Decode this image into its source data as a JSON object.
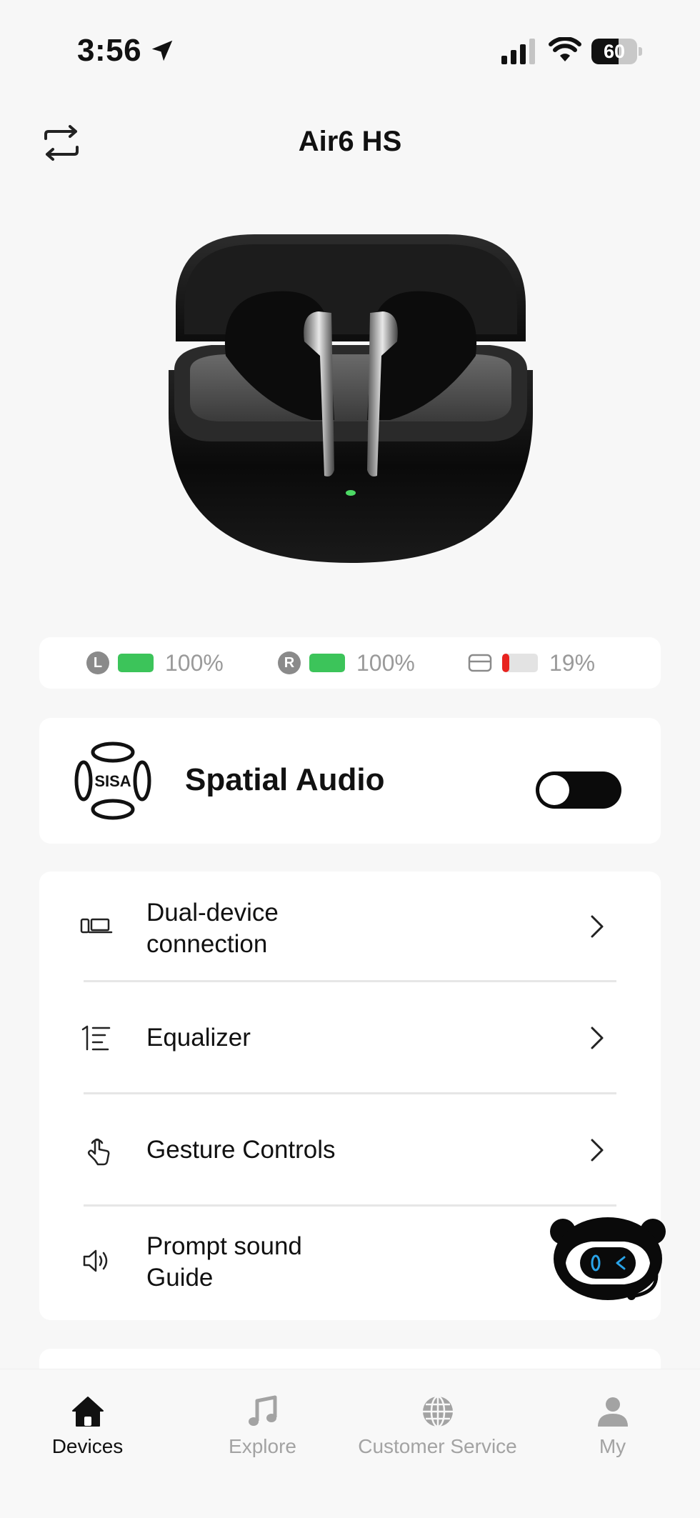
{
  "status_bar": {
    "time": "3:56",
    "battery_level": "60",
    "battery_fraction": 0.6
  },
  "header": {
    "title": "Air6 HS",
    "switch_icon": "swap-arrows-icon"
  },
  "product": {
    "image": "earbuds-in-charging-case"
  },
  "battery": {
    "left": {
      "badge": "L",
      "percent": "100%",
      "level": 1.0,
      "color": "#3cc45a"
    },
    "right": {
      "badge": "R",
      "percent": "100%",
      "level": 1.0,
      "color": "#3cc45a"
    },
    "case": {
      "icon": "case-icon",
      "percent": "19%",
      "level": 0.19,
      "color": "#e8231f"
    }
  },
  "spatial_audio": {
    "logo": "SISA",
    "label": "Spatial Audio",
    "enabled": false
  },
  "settings": [
    {
      "icon": "dual-device-icon",
      "label": "Dual-device connection"
    },
    {
      "icon": "equalizer-icon",
      "label": "Equalizer"
    },
    {
      "icon": "gesture-icon",
      "label": "Gesture Controls"
    },
    {
      "icon": "speaker-icon",
      "label": "Prompt sound Guide"
    }
  ],
  "tab_bar": {
    "tabs": [
      {
        "icon": "home-icon",
        "label": "Devices",
        "active": true
      },
      {
        "icon": "music-note-icon",
        "label": "Explore",
        "active": false
      },
      {
        "icon": "globe-icon",
        "label": "Customer Service",
        "active": false
      },
      {
        "icon": "person-icon",
        "label": "My",
        "active": false
      }
    ]
  },
  "colors": {
    "accent_green": "#3cc45a",
    "low_battery_red": "#e8231f",
    "background": "#f7f7f7"
  }
}
